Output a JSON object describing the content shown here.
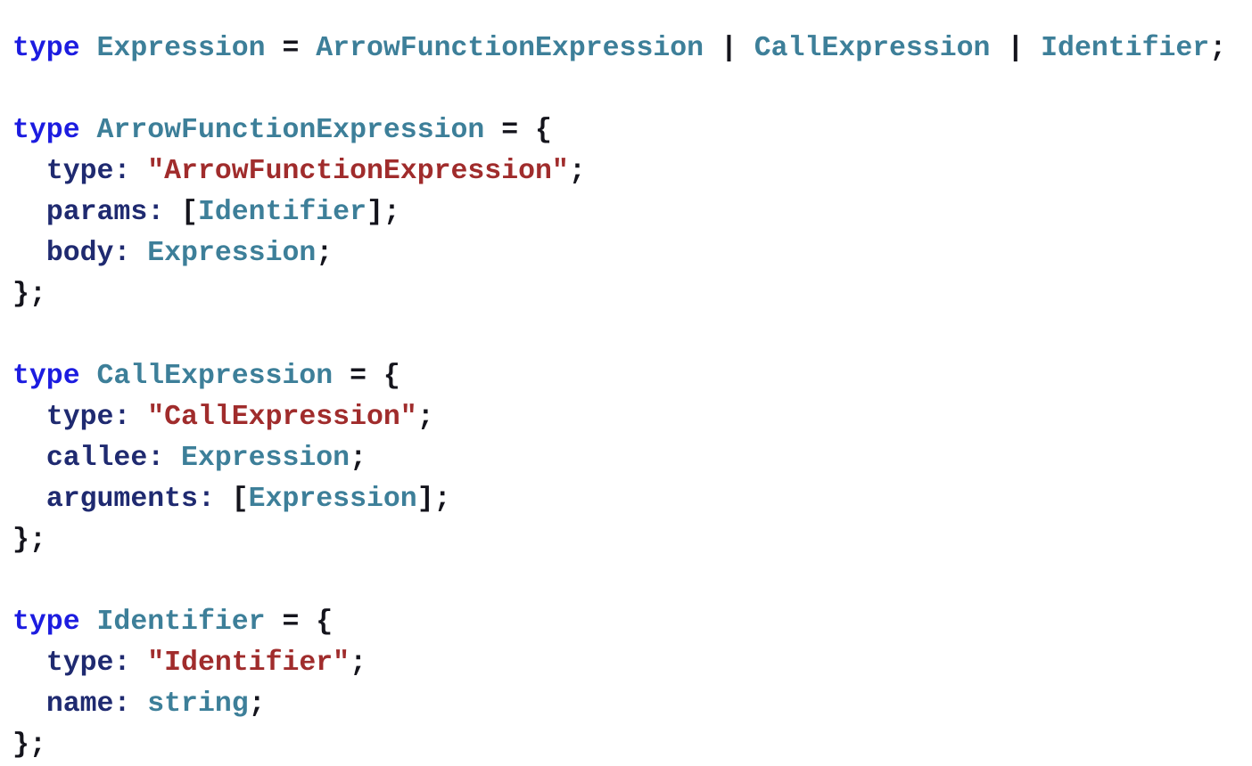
{
  "document": {
    "title": "TypeScript AST Type Definitions",
    "language": "typescript",
    "background_color": "#ffffff",
    "font_size_px": 31.5,
    "line_height_px": 46
  },
  "theme": {
    "keyword_color": "#1c1ce0",
    "typename_color": "#3d7f99",
    "typeref_color": "#3d7f99",
    "property_color": "#1f2a70",
    "string_color": "#a02c2c",
    "punctuation_color": "#14141c",
    "background_color": "#ffffff"
  },
  "code": {
    "lines": [
      {
        "index": 1,
        "indent": 0,
        "blank": false,
        "text": "type Expression = ArrowFunctionExpression | CallExpression | Identifier;",
        "tokens": [
          {
            "t": "keyword",
            "v": "type"
          },
          {
            "t": "plain",
            "v": " "
          },
          {
            "t": "typename",
            "v": "Expression"
          },
          {
            "t": "plain",
            "v": " "
          },
          {
            "t": "punct",
            "v": "="
          },
          {
            "t": "plain",
            "v": " "
          },
          {
            "t": "typeref",
            "v": "ArrowFunctionExpression"
          },
          {
            "t": "plain",
            "v": " "
          },
          {
            "t": "punct",
            "v": "|"
          },
          {
            "t": "plain",
            "v": " "
          },
          {
            "t": "typeref",
            "v": "CallExpression"
          },
          {
            "t": "plain",
            "v": " "
          },
          {
            "t": "punct",
            "v": "|"
          },
          {
            "t": "plain",
            "v": " "
          },
          {
            "t": "typeref",
            "v": "Identifier"
          },
          {
            "t": "punct",
            "v": ";"
          }
        ]
      },
      {
        "index": 2,
        "indent": 0,
        "blank": true,
        "text": "",
        "tokens": []
      },
      {
        "index": 3,
        "indent": 0,
        "blank": false,
        "text": "type ArrowFunctionExpression = {",
        "tokens": [
          {
            "t": "keyword",
            "v": "type"
          },
          {
            "t": "plain",
            "v": " "
          },
          {
            "t": "typename",
            "v": "ArrowFunctionExpression"
          },
          {
            "t": "plain",
            "v": " "
          },
          {
            "t": "punct",
            "v": "="
          },
          {
            "t": "plain",
            "v": " "
          },
          {
            "t": "punct",
            "v": "{"
          }
        ]
      },
      {
        "index": 4,
        "indent": 2,
        "blank": false,
        "text": "  type: \"ArrowFunctionExpression\";",
        "tokens": [
          {
            "t": "plain",
            "v": "  "
          },
          {
            "t": "property",
            "v": "type"
          },
          {
            "t": "property",
            "v": ":"
          },
          {
            "t": "plain",
            "v": " "
          },
          {
            "t": "string",
            "v": "\"ArrowFunctionExpression\""
          },
          {
            "t": "punct",
            "v": ";"
          }
        ]
      },
      {
        "index": 5,
        "indent": 2,
        "blank": false,
        "text": "  params: [Identifier];",
        "tokens": [
          {
            "t": "plain",
            "v": "  "
          },
          {
            "t": "property",
            "v": "params"
          },
          {
            "t": "property",
            "v": ":"
          },
          {
            "t": "plain",
            "v": " "
          },
          {
            "t": "punct",
            "v": "["
          },
          {
            "t": "typeref",
            "v": "Identifier"
          },
          {
            "t": "punct",
            "v": "]"
          },
          {
            "t": "punct",
            "v": ";"
          }
        ]
      },
      {
        "index": 6,
        "indent": 2,
        "blank": false,
        "text": "  body: Expression;",
        "tokens": [
          {
            "t": "plain",
            "v": "  "
          },
          {
            "t": "property",
            "v": "body"
          },
          {
            "t": "property",
            "v": ":"
          },
          {
            "t": "plain",
            "v": " "
          },
          {
            "t": "typeref",
            "v": "Expression"
          },
          {
            "t": "punct",
            "v": ";"
          }
        ]
      },
      {
        "index": 7,
        "indent": 0,
        "blank": false,
        "text": "};",
        "tokens": [
          {
            "t": "punct",
            "v": "}"
          },
          {
            "t": "punct",
            "v": ";"
          }
        ]
      },
      {
        "index": 8,
        "indent": 0,
        "blank": true,
        "text": "",
        "tokens": []
      },
      {
        "index": 9,
        "indent": 0,
        "blank": false,
        "text": "type CallExpression = {",
        "tokens": [
          {
            "t": "keyword",
            "v": "type"
          },
          {
            "t": "plain",
            "v": " "
          },
          {
            "t": "typename",
            "v": "CallExpression"
          },
          {
            "t": "plain",
            "v": " "
          },
          {
            "t": "punct",
            "v": "="
          },
          {
            "t": "plain",
            "v": " "
          },
          {
            "t": "punct",
            "v": "{"
          }
        ]
      },
      {
        "index": 10,
        "indent": 2,
        "blank": false,
        "text": "  type: \"CallExpression\";",
        "tokens": [
          {
            "t": "plain",
            "v": "  "
          },
          {
            "t": "property",
            "v": "type"
          },
          {
            "t": "property",
            "v": ":"
          },
          {
            "t": "plain",
            "v": " "
          },
          {
            "t": "string",
            "v": "\"CallExpression\""
          },
          {
            "t": "punct",
            "v": ";"
          }
        ]
      },
      {
        "index": 11,
        "indent": 2,
        "blank": false,
        "text": "  callee: Expression;",
        "tokens": [
          {
            "t": "plain",
            "v": "  "
          },
          {
            "t": "property",
            "v": "callee"
          },
          {
            "t": "property",
            "v": ":"
          },
          {
            "t": "plain",
            "v": " "
          },
          {
            "t": "typeref",
            "v": "Expression"
          },
          {
            "t": "punct",
            "v": ";"
          }
        ]
      },
      {
        "index": 12,
        "indent": 2,
        "blank": false,
        "text": "  arguments: [Expression];",
        "tokens": [
          {
            "t": "plain",
            "v": "  "
          },
          {
            "t": "property",
            "v": "arguments"
          },
          {
            "t": "property",
            "v": ":"
          },
          {
            "t": "plain",
            "v": " "
          },
          {
            "t": "punct",
            "v": "["
          },
          {
            "t": "typeref",
            "v": "Expression"
          },
          {
            "t": "punct",
            "v": "]"
          },
          {
            "t": "punct",
            "v": ";"
          }
        ]
      },
      {
        "index": 13,
        "indent": 0,
        "blank": false,
        "text": "};",
        "tokens": [
          {
            "t": "punct",
            "v": "}"
          },
          {
            "t": "punct",
            "v": ";"
          }
        ]
      },
      {
        "index": 14,
        "indent": 0,
        "blank": true,
        "text": "",
        "tokens": []
      },
      {
        "index": 15,
        "indent": 0,
        "blank": false,
        "text": "type Identifier = {",
        "tokens": [
          {
            "t": "keyword",
            "v": "type"
          },
          {
            "t": "plain",
            "v": " "
          },
          {
            "t": "typename",
            "v": "Identifier"
          },
          {
            "t": "plain",
            "v": " "
          },
          {
            "t": "punct",
            "v": "="
          },
          {
            "t": "plain",
            "v": " "
          },
          {
            "t": "punct",
            "v": "{"
          }
        ]
      },
      {
        "index": 16,
        "indent": 2,
        "blank": false,
        "text": "  type: \"Identifier\";",
        "tokens": [
          {
            "t": "plain",
            "v": "  "
          },
          {
            "t": "property",
            "v": "type"
          },
          {
            "t": "property",
            "v": ":"
          },
          {
            "t": "plain",
            "v": " "
          },
          {
            "t": "string",
            "v": "\"Identifier\""
          },
          {
            "t": "punct",
            "v": ";"
          }
        ]
      },
      {
        "index": 17,
        "indent": 2,
        "blank": false,
        "text": "  name: string;",
        "tokens": [
          {
            "t": "plain",
            "v": "  "
          },
          {
            "t": "property",
            "v": "name"
          },
          {
            "t": "property",
            "v": ":"
          },
          {
            "t": "plain",
            "v": " "
          },
          {
            "t": "typeref",
            "v": "string"
          },
          {
            "t": "punct",
            "v": ";"
          }
        ]
      },
      {
        "index": 18,
        "indent": 0,
        "blank": false,
        "text": "};",
        "tokens": [
          {
            "t": "punct",
            "v": "}"
          },
          {
            "t": "punct",
            "v": ";"
          }
        ]
      }
    ]
  }
}
